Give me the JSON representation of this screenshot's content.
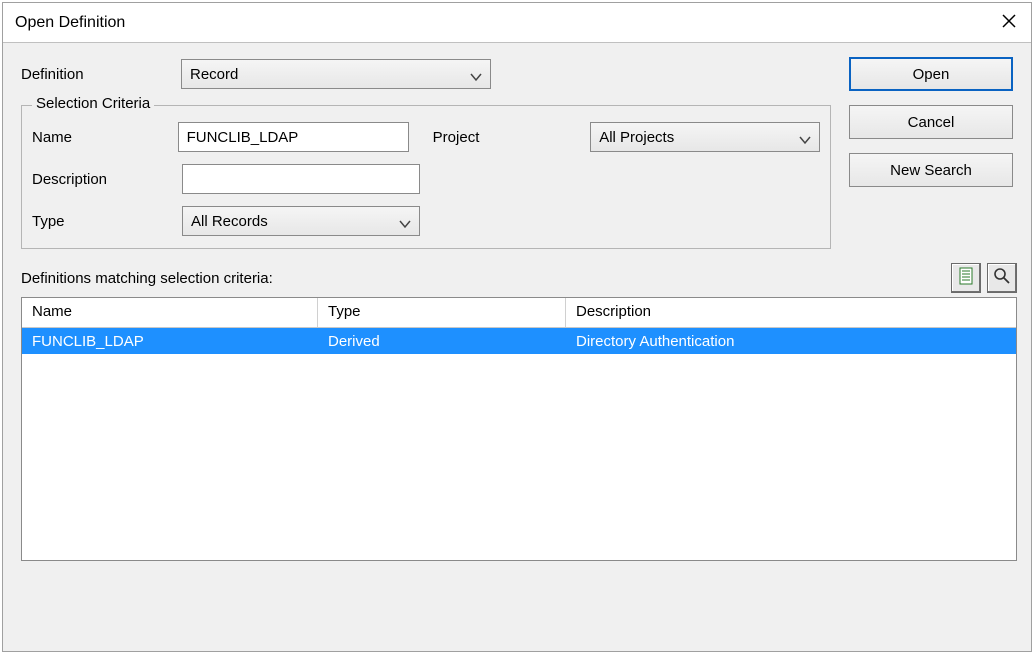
{
  "window": {
    "title": "Open Definition"
  },
  "labels": {
    "definition": "Definition",
    "selection_criteria": "Selection Criteria",
    "name": "Name",
    "project": "Project",
    "description": "Description",
    "type": "Type",
    "matching": "Definitions matching selection criteria:"
  },
  "inputs": {
    "definition_select": "Record",
    "name_value": "FUNCLIB_LDAP",
    "description_value": "",
    "type_select": "All Records",
    "project_select": "All Projects"
  },
  "buttons": {
    "open": "Open",
    "cancel": "Cancel",
    "new_search": "New Search"
  },
  "icons": {
    "list": "list-icon",
    "find": "magnifier-icon"
  },
  "table": {
    "headers": {
      "name": "Name",
      "type": "Type",
      "description": "Description"
    },
    "rows": [
      {
        "name": "FUNCLIB_LDAP",
        "type": "Derived",
        "description": "Directory Authentication"
      }
    ]
  }
}
